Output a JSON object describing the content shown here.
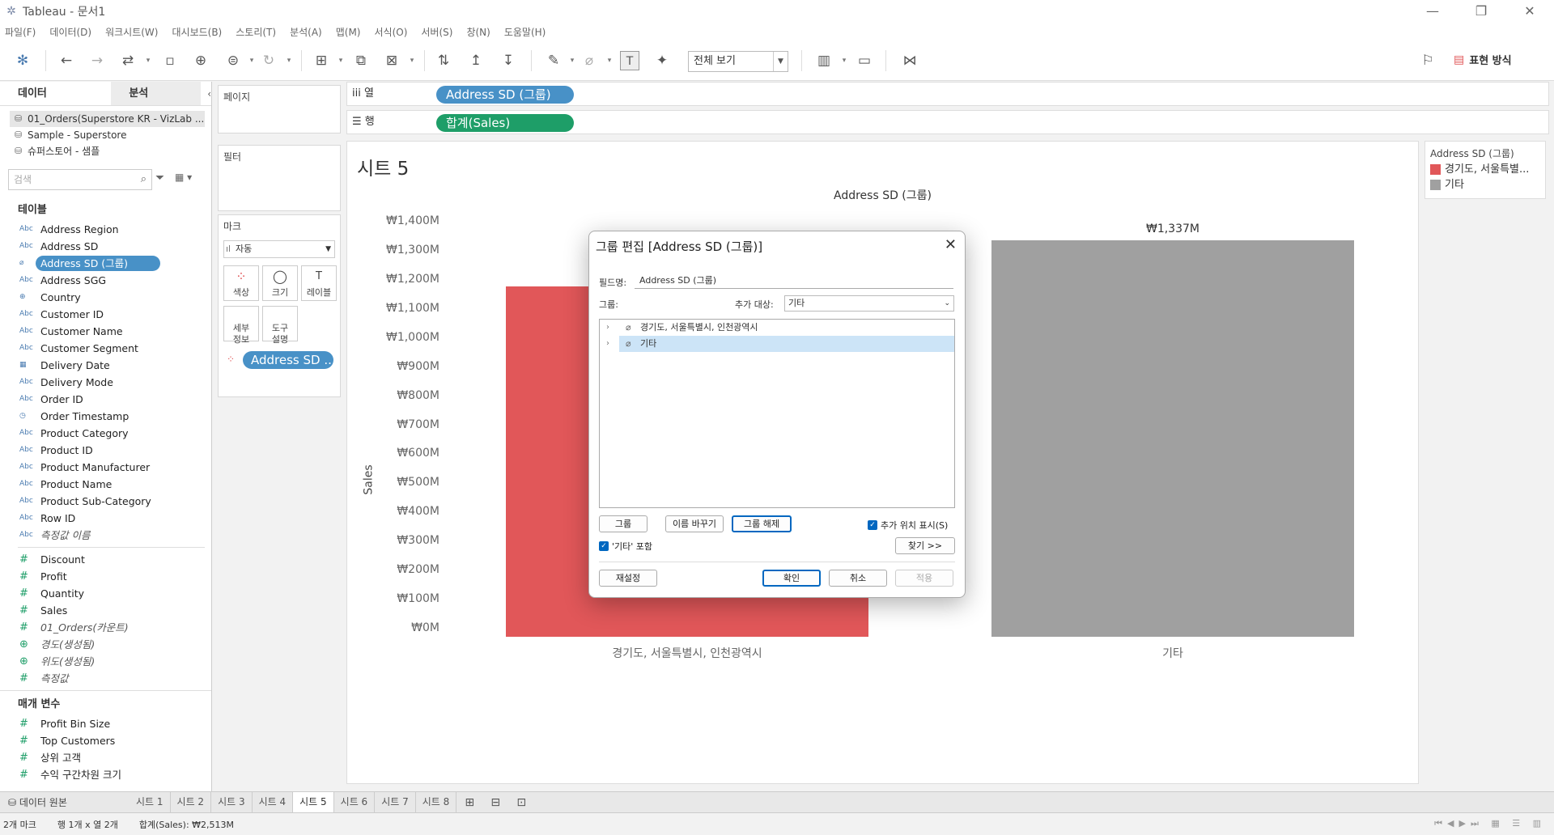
{
  "window": {
    "title": "Tableau - 문서1",
    "controls": [
      "—",
      "❐",
      "✕"
    ]
  },
  "menu": [
    "파일(F)",
    "데이터(D)",
    "워크시트(W)",
    "대시보드(B)",
    "스토리(T)",
    "분석(A)",
    "맵(M)",
    "서식(O)",
    "서버(S)",
    "창(N)",
    "도움말(H)"
  ],
  "toolbar": {
    "fit_select": "전체 보기",
    "show_me": "표현 방식"
  },
  "data_pane": {
    "tab_data": "데이터",
    "tab_analysis": "분석",
    "collapse": "‹",
    "datasources": [
      "01_Orders(Superstore KR - VizLab ...",
      "Sample - Superstore",
      "슈퍼스토어 - 샘플"
    ],
    "search_placeholder": "검색",
    "tables_title": "테이블",
    "dimensions": [
      {
        "type": "Abc",
        "name": "Address Region"
      },
      {
        "type": "Abc",
        "name": "Address SD"
      },
      {
        "type": "⌀",
        "name": "Address SD (그룹)"
      },
      {
        "type": "Abc",
        "name": "Address SGG"
      },
      {
        "type": "⊕",
        "name": "Country"
      },
      {
        "type": "Abc",
        "name": "Customer ID"
      },
      {
        "type": "Abc",
        "name": "Customer Name"
      },
      {
        "type": "Abc",
        "name": "Customer Segment"
      },
      {
        "type": "▦",
        "name": "Delivery Date"
      },
      {
        "type": "Abc",
        "name": "Delivery Mode"
      },
      {
        "type": "Abc",
        "name": "Order ID"
      },
      {
        "type": "◷",
        "name": "Order Timestamp"
      },
      {
        "type": "Abc",
        "name": "Product Category"
      },
      {
        "type": "Abc",
        "name": "Product ID"
      },
      {
        "type": "Abc",
        "name": "Product Manufacturer"
      },
      {
        "type": "Abc",
        "name": "Product Name"
      },
      {
        "type": "Abc",
        "name": "Product Sub-Category"
      },
      {
        "type": "Abc",
        "name": "Row ID"
      },
      {
        "type": "Abc",
        "name": "측정값 이름"
      }
    ],
    "measures": [
      {
        "type": "#",
        "name": "Discount"
      },
      {
        "type": "#",
        "name": "Profit"
      },
      {
        "type": "#",
        "name": "Quantity"
      },
      {
        "type": "#",
        "name": "Sales"
      },
      {
        "type": "#",
        "name": "01_Orders(카운트)"
      },
      {
        "type": "⊕",
        "name": "경도(생성됨)"
      },
      {
        "type": "⊕",
        "name": "위도(생성됨)"
      },
      {
        "type": "#",
        "name": "측정값"
      }
    ],
    "params_title": "매개 변수",
    "parameters": [
      {
        "type": "#",
        "name": "Profit Bin Size"
      },
      {
        "type": "#",
        "name": "Top Customers"
      },
      {
        "type": "#",
        "name": "상위 고객"
      },
      {
        "type": "#",
        "name": "수익 구간차원 크기"
      }
    ]
  },
  "shelves": {
    "pages": "페이지",
    "filters": "필터",
    "marks": "마크",
    "marks_type": "자동",
    "mark_buttons": [
      {
        "icon": "⁘",
        "label": "색상"
      },
      {
        "icon": "◯",
        "label": "크기"
      },
      {
        "icon": "T",
        "label": "레이블"
      },
      {
        "icon": "",
        "label": "세부\n정보"
      },
      {
        "icon": "",
        "label": "도구\n설명"
      }
    ],
    "mark_pill": "Address SD ...",
    "columns_label": "iii 열",
    "columns_pill": "Address SD (그룹)",
    "rows_label": "☰ 행",
    "rows_pill": "합계(Sales)"
  },
  "sheet": {
    "title": "시트 5"
  },
  "chart_data": {
    "type": "bar",
    "title": "Address SD (그룹)",
    "xlabel": "",
    "ylabel": "Sales",
    "categories": [
      "경기도, 서울특별시, 인천광역시",
      "기타"
    ],
    "values": [
      1176,
      1337
    ],
    "value_unit": "₩M",
    "data_labels": [
      "",
      "₩1,337M"
    ],
    "colors": [
      "#e15759",
      "#a0a0a0"
    ],
    "ylim": [
      0,
      1400
    ],
    "yticks": [
      "₩0M",
      "₩100M",
      "₩200M",
      "₩300M",
      "₩400M",
      "₩500M",
      "₩600M",
      "₩700M",
      "₩800M",
      "₩900M",
      "₩1,000M",
      "₩1,100M",
      "₩1,200M",
      "₩1,300M",
      "₩1,400M"
    ],
    "ytick_values": [
      0,
      100,
      200,
      300,
      400,
      500,
      600,
      700,
      800,
      900,
      1000,
      1100,
      1200,
      1300,
      1400
    ],
    "grid": false
  },
  "legend": {
    "title": "Address SD (그룹)",
    "items": [
      {
        "label": "경기도, 서울특별...",
        "color": "#e15759"
      },
      {
        "label": "기타",
        "color": "#a0a0a0"
      }
    ]
  },
  "dialog": {
    "title": "그룹 편집 [Address SD (그룹)]",
    "field_name_label": "필드명:",
    "field_name": "Address SD (그룹)",
    "groups_label": "그룹:",
    "add_to_label": "추가 대상:",
    "add_to_value": "기타",
    "groups": [
      "경기도, 서울특별시, 인천광역시",
      "기타"
    ],
    "btn_group": "그룹",
    "btn_rename": "이름 바꾸기",
    "btn_ungroup": "그룹 해제",
    "show_added_label": "추가 위치 표시(S)",
    "include_other_label": "'기타' 포함",
    "btn_find": "찾기 >>",
    "btn_reset": "재설정",
    "btn_ok": "확인",
    "btn_cancel": "취소",
    "btn_apply": "적용"
  },
  "tabs": {
    "datasource": "데이터 원본",
    "sheets": [
      "시트 1",
      "시트 2",
      "시트 3",
      "시트 4",
      "시트 5",
      "시트 6",
      "시트 7",
      "시트 8"
    ],
    "active": "시트 5"
  },
  "status": {
    "marks": "2개 마크",
    "dims": "행 1개 x 열 2개",
    "sum": "합계(Sales): ₩2,513M"
  }
}
